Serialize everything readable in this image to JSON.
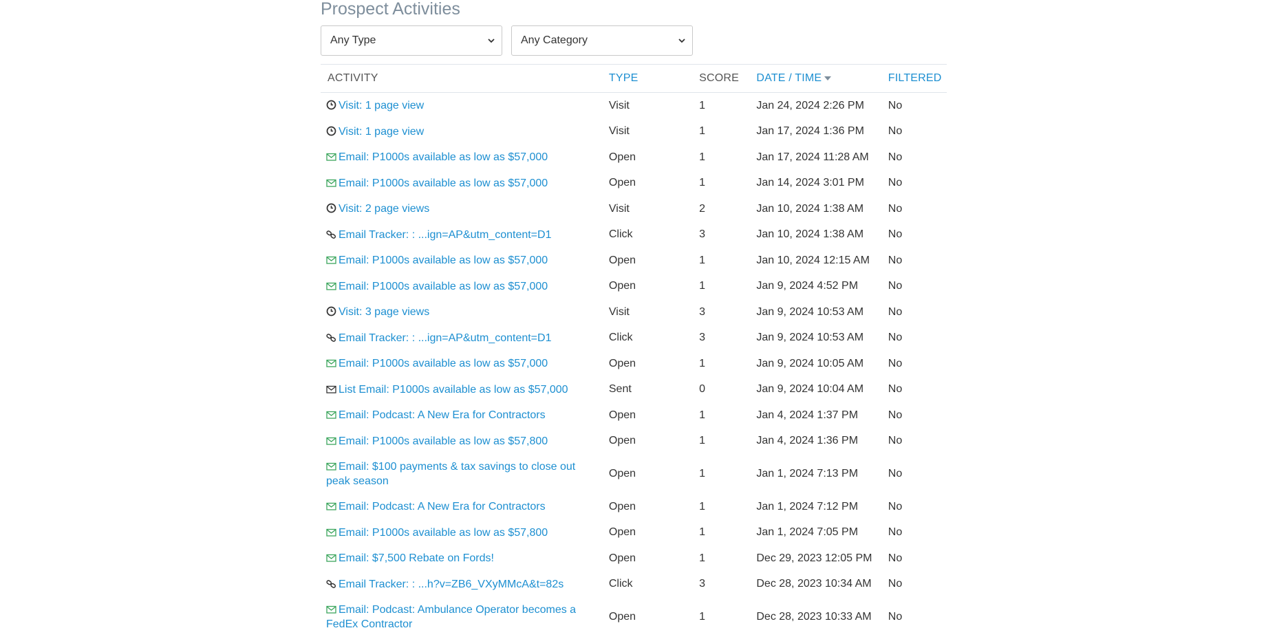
{
  "title": "Prospect Activities",
  "filters": {
    "type_selected": "Any Type",
    "category_selected": "Any Category"
  },
  "columns": {
    "activity": "ACTIVITY",
    "type": "TYPE",
    "score": "SCORE",
    "date_time": "DATE / TIME",
    "filtered": "FILTERED"
  },
  "icons": {
    "visit": "clock-icon",
    "email": "envelope-open-icon",
    "tracker": "link-icon",
    "list_email": "envelope-icon"
  },
  "colors": {
    "link": "#1d8fd1",
    "email_icon": "#3ba55c",
    "title": "#7e8e9c"
  },
  "rows": [
    {
      "kind": "visit",
      "activity": "Visit: 1 page view",
      "type": "Visit",
      "score": "1",
      "date": "Jan 24, 2024 2:26 PM",
      "filtered": "No"
    },
    {
      "kind": "visit",
      "activity": "Visit: 1 page view",
      "type": "Visit",
      "score": "1",
      "date": "Jan 17, 2024 1:36 PM",
      "filtered": "No"
    },
    {
      "kind": "email",
      "activity": "Email: P1000s available as low as $57,000",
      "type": "Open",
      "score": "1",
      "date": "Jan 17, 2024 11:28 AM",
      "filtered": "No"
    },
    {
      "kind": "email",
      "activity": "Email: P1000s available as low as $57,000",
      "type": "Open",
      "score": "1",
      "date": "Jan 14, 2024 3:01 PM",
      "filtered": "No"
    },
    {
      "kind": "visit",
      "activity": "Visit: 2 page views",
      "type": "Visit",
      "score": "2",
      "date": "Jan 10, 2024 1:38 AM",
      "filtered": "No"
    },
    {
      "kind": "tracker",
      "activity": "Email Tracker: : ...ign=AP&utm_content=D1",
      "type": "Click",
      "score": "3",
      "date": "Jan 10, 2024 1:38 AM",
      "filtered": "No"
    },
    {
      "kind": "email",
      "activity": "Email: P1000s available as low as $57,000",
      "type": "Open",
      "score": "1",
      "date": "Jan 10, 2024 12:15 AM",
      "filtered": "No"
    },
    {
      "kind": "email",
      "activity": "Email: P1000s available as low as $57,000",
      "type": "Open",
      "score": "1",
      "date": "Jan 9, 2024 4:52 PM",
      "filtered": "No"
    },
    {
      "kind": "visit",
      "activity": "Visit: 3 page views",
      "type": "Visit",
      "score": "3",
      "date": "Jan 9, 2024 10:53 AM",
      "filtered": "No"
    },
    {
      "kind": "tracker",
      "activity": "Email Tracker: : ...ign=AP&utm_content=D1",
      "type": "Click",
      "score": "3",
      "date": "Jan 9, 2024 10:53 AM",
      "filtered": "No"
    },
    {
      "kind": "email",
      "activity": "Email: P1000s available as low as $57,000",
      "type": "Open",
      "score": "1",
      "date": "Jan 9, 2024 10:05 AM",
      "filtered": "No"
    },
    {
      "kind": "list_email",
      "activity": "List Email: P1000s available as low as $57,000",
      "type": "Sent",
      "score": "0",
      "date": "Jan 9, 2024 10:04 AM",
      "filtered": "No"
    },
    {
      "kind": "email",
      "activity": "Email: Podcast: A New Era for Contractors",
      "type": "Open",
      "score": "1",
      "date": "Jan 4, 2024 1:37 PM",
      "filtered": "No"
    },
    {
      "kind": "email",
      "activity": "Email: P1000s available as low as $57,800",
      "type": "Open",
      "score": "1",
      "date": "Jan 4, 2024 1:36 PM",
      "filtered": "No"
    },
    {
      "kind": "email",
      "activity": "Email: $100 payments & tax savings to close out peak season",
      "type": "Open",
      "score": "1",
      "date": "Jan 1, 2024 7:13 PM",
      "filtered": "No",
      "tall": true
    },
    {
      "kind": "email",
      "activity": "Email: Podcast: A New Era for Contractors",
      "type": "Open",
      "score": "1",
      "date": "Jan 1, 2024 7:12 PM",
      "filtered": "No"
    },
    {
      "kind": "email",
      "activity": "Email: P1000s available as low as $57,800",
      "type": "Open",
      "score": "1",
      "date": "Jan 1, 2024 7:05 PM",
      "filtered": "No"
    },
    {
      "kind": "email",
      "activity": "Email: $7,500 Rebate on Fords!",
      "type": "Open",
      "score": "1",
      "date": "Dec 29, 2023 12:05 PM",
      "filtered": "No"
    },
    {
      "kind": "tracker",
      "activity": "Email Tracker: : ...h?v=ZB6_VXyMMcA&t=82s",
      "type": "Click",
      "score": "3",
      "date": "Dec 28, 2023 10:34 AM",
      "filtered": "No"
    },
    {
      "kind": "email",
      "activity": "Email: Podcast: Ambulance Operator becomes a FedEx Contractor",
      "type": "Open",
      "score": "1",
      "date": "Dec 28, 2023 10:33 AM",
      "filtered": "No",
      "tall": true
    }
  ]
}
